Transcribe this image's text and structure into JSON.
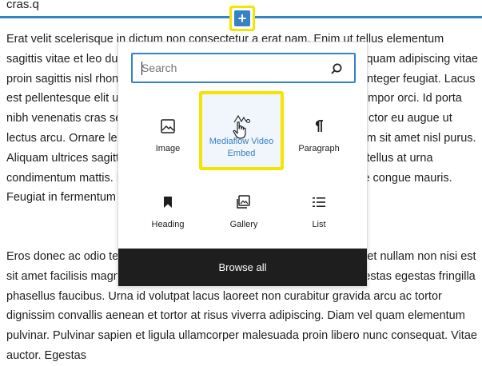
{
  "content": {
    "cut_line": "cras.q",
    "paragraph1": "Erat velit scelerisque in dictum non consectetur a erat nam. Enim ut tellus elementum sagittis vitae et leo duis ut diam quam nulla porttitor. Nisi quis eleifend quam adipiscing vitae proin sagittis nisl rhoncus. Tortor at risus viverra adipiscing at in tellus integer feugiat. Lacus est pellentesque elit ullamcorper dignissim cras. Eros donec ac odio tempor orci. Id porta nibh venenatis cras sed felis eget velit. Scelerisque eu ultrices vitae auctor eu augue ut lectus arcu. Ornare lectus sit amet. Non sodales neque sodales ut etiam sit amet nisl purus. Aliquam ultrices sagittis orci a scelerisque purus semper eget. Duis at tellus at urna condimentum mattis. Facilisi nullam vehicula ipsum a arcu cursus vitae congue mauris. Feugiat in fermentum posuere urna nec tincidunt praesent.",
    "paragraph2": "Eros donec ac odio tempor orci dapibus ultrices in iaculis. Tincidunt eget nullam non nisi est sit amet facilisis magna. Pellentesque diam volutpat commodo sed egestas egestas fringilla phasellus faucibus. Urna id volutpat lacus laoreet non curabitur gravida arcu ac tortor dignissim convallis aenean et tortor at risus viverra adipiscing. Diam vel quam elementum pulvinar. Pulvinar sapien et ligula ullamcorper malesuada proin libero nunc consequat. Vitae auctor. Egestas"
  },
  "inserter": {
    "symbol": "+"
  },
  "popover": {
    "search_placeholder": "Search",
    "blocks": [
      {
        "label": "Image",
        "icon": "image-icon"
      },
      {
        "label": "Mediaflow Video Embed",
        "icon": "mediaflow-icon"
      },
      {
        "label": "Paragraph",
        "icon": "paragraph-icon"
      },
      {
        "label": "Heading",
        "icon": "bookmark-icon"
      },
      {
        "label": "Gallery",
        "icon": "gallery-icon"
      },
      {
        "label": "List",
        "icon": "list-icon"
      }
    ],
    "browse_all": "Browse all"
  },
  "colors": {
    "accent": "#3582c4",
    "highlight": "#f5e400",
    "dark": "#1e1e1e"
  }
}
